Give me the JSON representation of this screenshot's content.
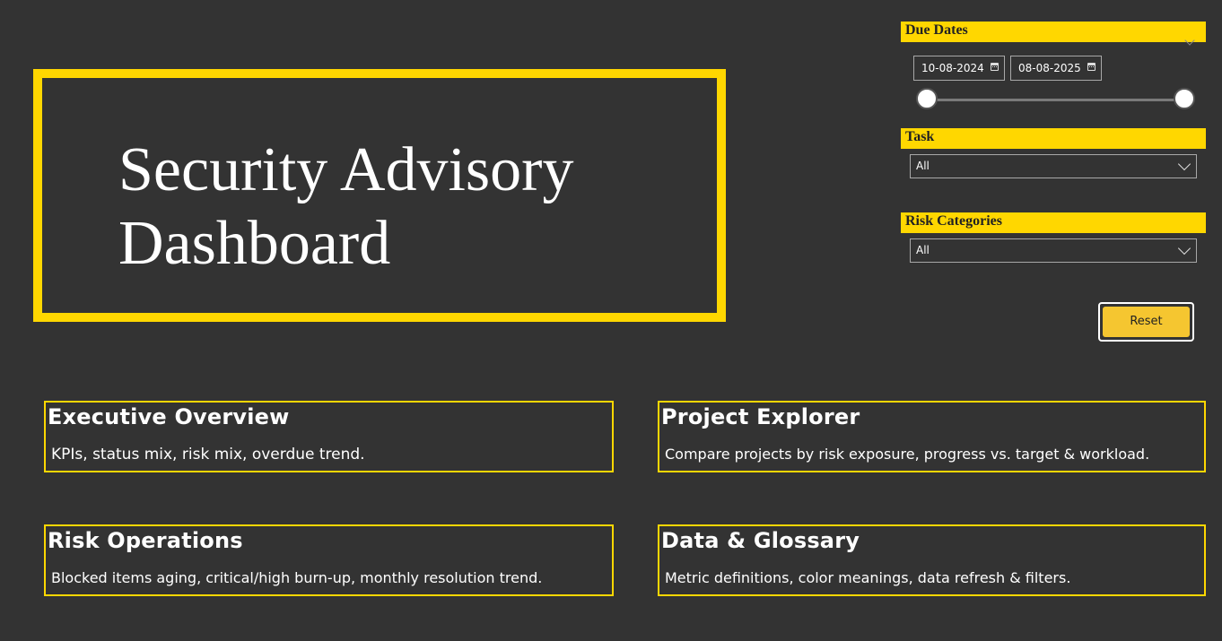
{
  "title": {
    "line1": "Security Advisory",
    "line2": "Dashboard"
  },
  "filters": {
    "due_dates": {
      "label": "Due Dates",
      "start": "10-08-2024",
      "end": "08-08-2025"
    },
    "task": {
      "label": "Task",
      "value": "All"
    },
    "risk_categories": {
      "label": "Risk Categories",
      "value": "All"
    },
    "reset_label": "Reset"
  },
  "nav": [
    {
      "title": "Executive Overview",
      "desc": "KPIs, status mix, risk mix, overdue trend."
    },
    {
      "title": "Project Explorer",
      "desc": "Compare projects by risk exposure, progress vs. target & workload."
    },
    {
      "title": "Risk Operations",
      "desc": "Blocked items aging, critical/high burn-up, monthly resolution trend."
    },
    {
      "title": "Data & Glossary",
      "desc": "Metric definitions, color meanings, data refresh & filters."
    }
  ],
  "colors": {
    "background": "#333333",
    "accent": "#FFD700",
    "button": "#F5C630"
  }
}
